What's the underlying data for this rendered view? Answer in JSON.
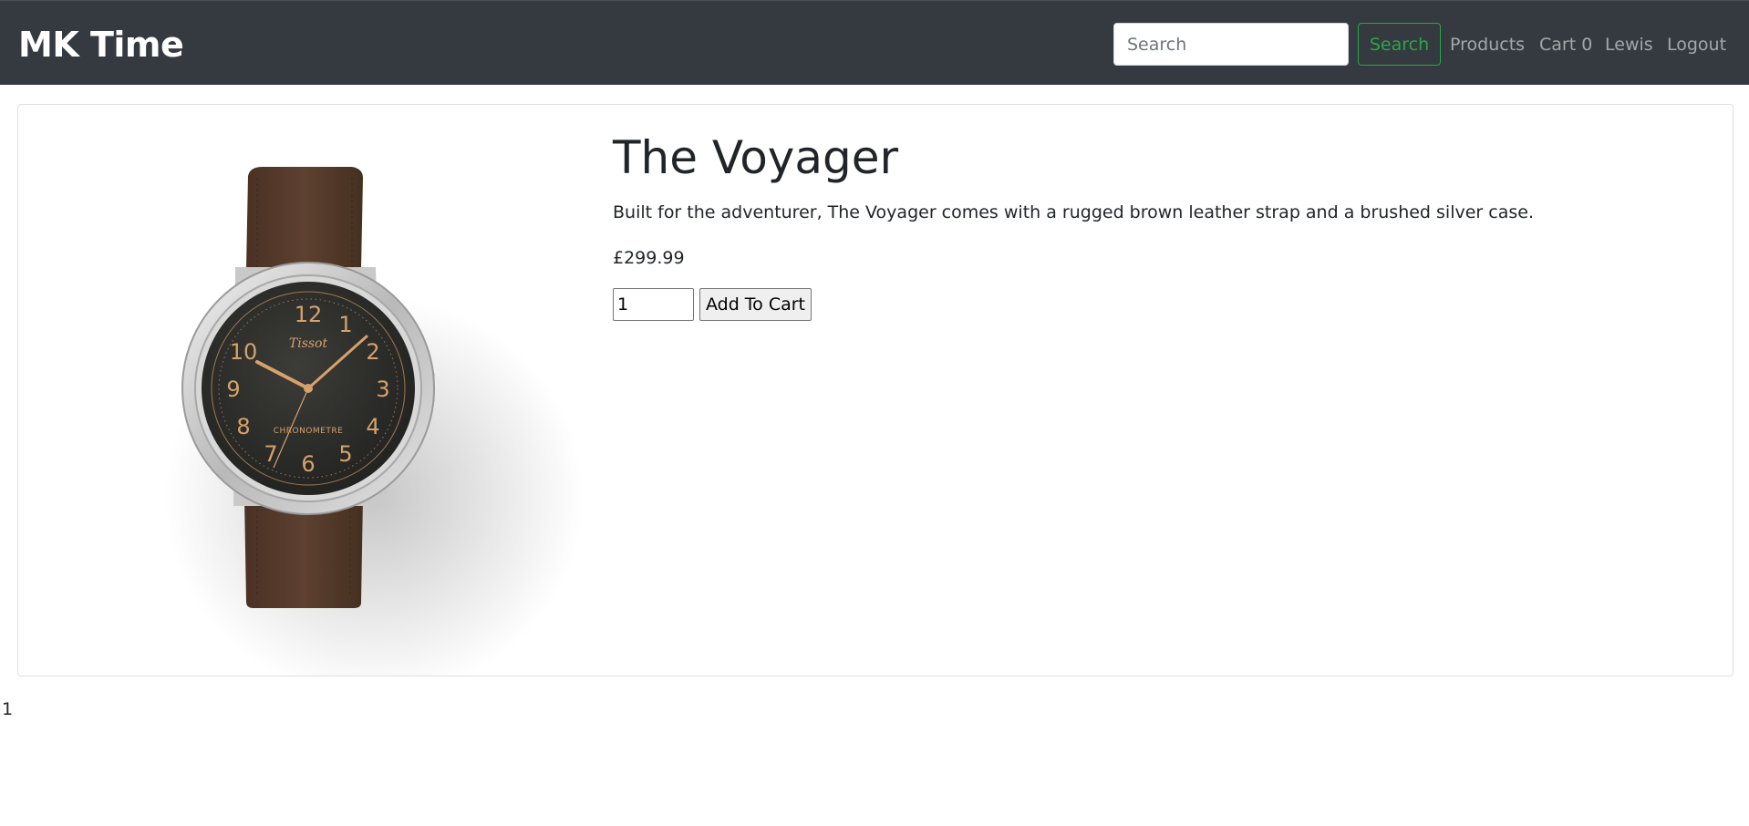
{
  "navbar": {
    "brand": "MK Time",
    "search_placeholder": "Search",
    "search_button": "Search",
    "links": {
      "products": "Products",
      "cart": "Cart 0",
      "user": "Lewis",
      "logout": "Logout"
    }
  },
  "product": {
    "title": "The Voyager",
    "description": "Built for the adventurer, The Voyager comes with a rugged brown leather strap and a brushed silver case.",
    "price": "£299.99",
    "quantity": "1",
    "add_button": "Add To Cart",
    "watch_brand": "Tissot",
    "dial_text": "CHRONOMETRE",
    "dial_numerals": [
      "12",
      "1",
      "2",
      "3",
      "4",
      "5",
      "6",
      "7",
      "8",
      "9",
      "10"
    ]
  },
  "footer": {
    "number": "1"
  },
  "colors": {
    "navbar_bg": "#343a40",
    "search_accent": "#28a745",
    "strap": "#5a3c2c",
    "dial": "#2f2f2c",
    "numerals": "#d6a26a"
  }
}
